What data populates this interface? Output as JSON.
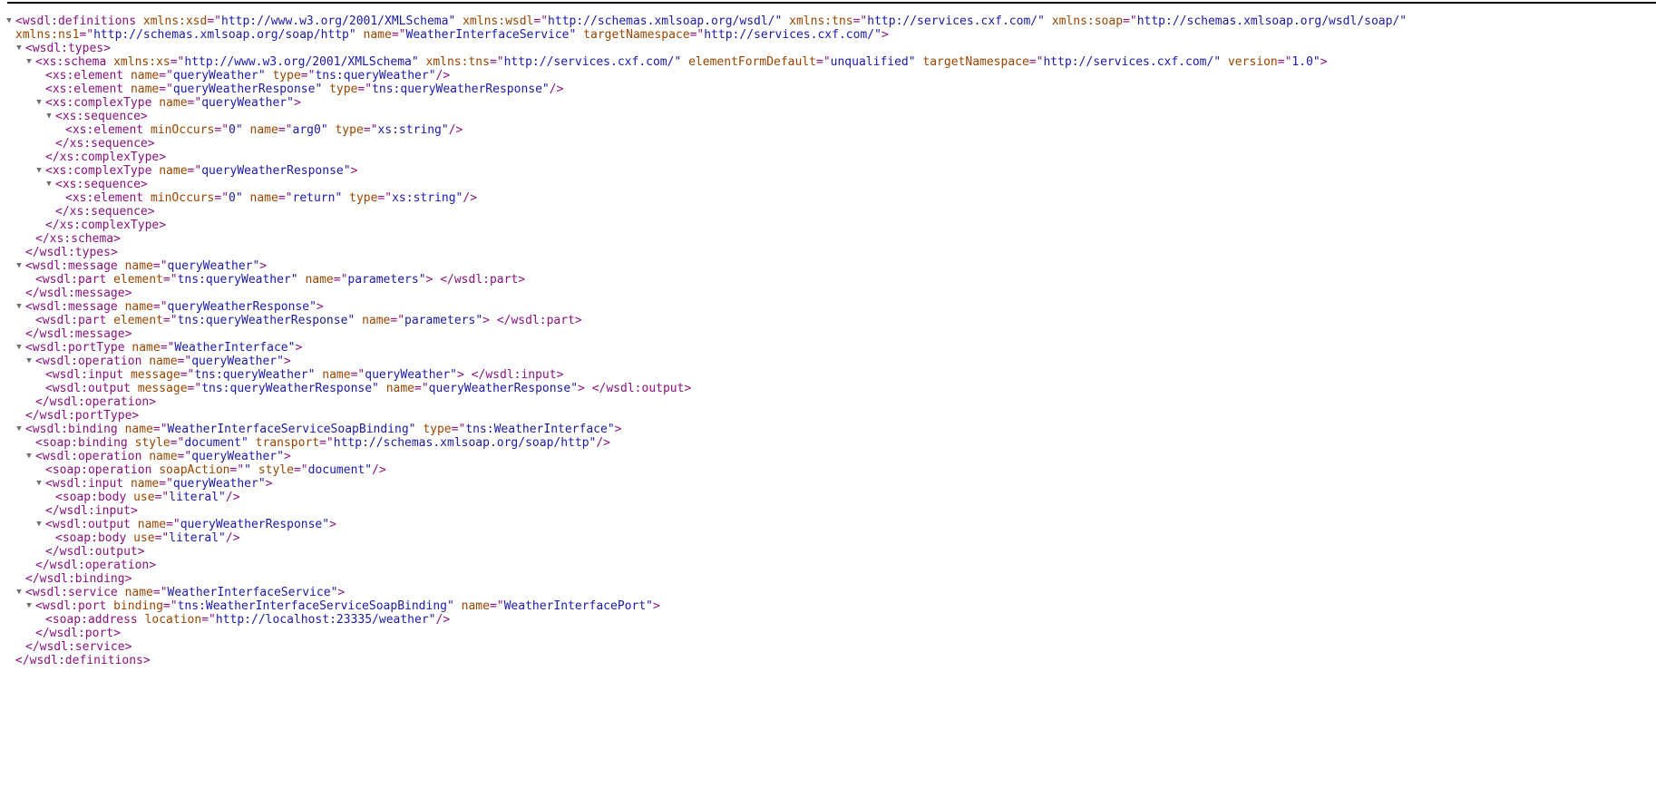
{
  "caret_glyph": "▼",
  "colors": {
    "tag": "#881280",
    "attribute_name": "#994500",
    "attribute_value": "#1a1aa6",
    "caret": "#6e6e6e",
    "rule": "#000000"
  },
  "lines": [
    {
      "indent": 0,
      "caret": true,
      "close": false,
      "tag": "wsdl:definitions",
      "attrs": [
        [
          "xmlns:xsd",
          "http://www.w3.org/2001/XMLSchema"
        ],
        [
          "xmlns:wsdl",
          "http://schemas.xmlsoap.org/wsdl/"
        ],
        [
          "xmlns:tns",
          "http://services.cxf.com/"
        ],
        [
          "xmlns:soap",
          "http://schemas.xmlsoap.org/wsdl/soap/"
        ]
      ],
      "end": ""
    },
    {
      "indent": 0,
      "cont": true,
      "close": false,
      "tag": "",
      "attrs": [
        [
          "xmlns:ns1",
          "http://schemas.xmlsoap.org/soap/http"
        ],
        [
          "name",
          "WeatherInterfaceService"
        ],
        [
          "targetNamespace",
          "http://services.cxf.com/"
        ]
      ],
      "end": ">"
    },
    {
      "indent": 1,
      "caret": true,
      "close": false,
      "tag": "wsdl:types",
      "attrs": [],
      "end": ">"
    },
    {
      "indent": 2,
      "caret": true,
      "close": false,
      "tag": "xs:schema",
      "attrs": [
        [
          "xmlns:xs",
          "http://www.w3.org/2001/XMLSchema"
        ],
        [
          "xmlns:tns",
          "http://services.cxf.com/"
        ],
        [
          "elementFormDefault",
          "unqualified"
        ],
        [
          "targetNamespace",
          "http://services.cxf.com/"
        ],
        [
          "version",
          "1.0"
        ]
      ],
      "end": ">"
    },
    {
      "indent": 3,
      "close": false,
      "tag": "xs:element",
      "attrs": [
        [
          "name",
          "queryWeather"
        ],
        [
          "type",
          "tns:queryWeather"
        ]
      ],
      "end": "/>"
    },
    {
      "indent": 3,
      "close": false,
      "tag": "xs:element",
      "attrs": [
        [
          "name",
          "queryWeatherResponse"
        ],
        [
          "type",
          "tns:queryWeatherResponse"
        ]
      ],
      "end": "/>"
    },
    {
      "indent": 3,
      "caret": true,
      "close": false,
      "tag": "xs:complexType",
      "attrs": [
        [
          "name",
          "queryWeather"
        ]
      ],
      "end": ">"
    },
    {
      "indent": 4,
      "caret": true,
      "close": false,
      "tag": "xs:sequence",
      "attrs": [],
      "end": ">"
    },
    {
      "indent": 5,
      "close": false,
      "tag": "xs:element",
      "attrs": [
        [
          "minOccurs",
          "0"
        ],
        [
          "name",
          "arg0"
        ],
        [
          "type",
          "xs:string"
        ]
      ],
      "end": "/>"
    },
    {
      "indent": 4,
      "close": true,
      "tag": "xs:sequence",
      "attrs": [],
      "end": ">"
    },
    {
      "indent": 3,
      "close": true,
      "tag": "xs:complexType",
      "attrs": [],
      "end": ">"
    },
    {
      "indent": 3,
      "caret": true,
      "close": false,
      "tag": "xs:complexType",
      "attrs": [
        [
          "name",
          "queryWeatherResponse"
        ]
      ],
      "end": ">"
    },
    {
      "indent": 4,
      "caret": true,
      "close": false,
      "tag": "xs:sequence",
      "attrs": [],
      "end": ">"
    },
    {
      "indent": 5,
      "close": false,
      "tag": "xs:element",
      "attrs": [
        [
          "minOccurs",
          "0"
        ],
        [
          "name",
          "return"
        ],
        [
          "type",
          "xs:string"
        ]
      ],
      "end": "/>"
    },
    {
      "indent": 4,
      "close": true,
      "tag": "xs:sequence",
      "attrs": [],
      "end": ">"
    },
    {
      "indent": 3,
      "close": true,
      "tag": "xs:complexType",
      "attrs": [],
      "end": ">"
    },
    {
      "indent": 2,
      "close": true,
      "tag": "xs:schema",
      "attrs": [],
      "end": ">"
    },
    {
      "indent": 1,
      "close": true,
      "tag": "wsdl:types",
      "attrs": [],
      "end": ">"
    },
    {
      "indent": 1,
      "caret": true,
      "close": false,
      "tag": "wsdl:message",
      "attrs": [
        [
          "name",
          "queryWeather"
        ]
      ],
      "end": ">"
    },
    {
      "indent": 2,
      "close": false,
      "tag": "wsdl:part",
      "attrs": [
        [
          "element",
          "tns:queryWeather"
        ],
        [
          "name",
          "parameters"
        ]
      ],
      "end": ">",
      "closing": "wsdl:part"
    },
    {
      "indent": 1,
      "close": true,
      "tag": "wsdl:message",
      "attrs": [],
      "end": ">"
    },
    {
      "indent": 1,
      "caret": true,
      "close": false,
      "tag": "wsdl:message",
      "attrs": [
        [
          "name",
          "queryWeatherResponse"
        ]
      ],
      "end": ">"
    },
    {
      "indent": 2,
      "close": false,
      "tag": "wsdl:part",
      "attrs": [
        [
          "element",
          "tns:queryWeatherResponse"
        ],
        [
          "name",
          "parameters"
        ]
      ],
      "end": ">",
      "closing": "wsdl:part"
    },
    {
      "indent": 1,
      "close": true,
      "tag": "wsdl:message",
      "attrs": [],
      "end": ">"
    },
    {
      "indent": 1,
      "caret": true,
      "close": false,
      "tag": "wsdl:portType",
      "attrs": [
        [
          "name",
          "WeatherInterface"
        ]
      ],
      "end": ">"
    },
    {
      "indent": 2,
      "caret": true,
      "close": false,
      "tag": "wsdl:operation",
      "attrs": [
        [
          "name",
          "queryWeather"
        ]
      ],
      "end": ">"
    },
    {
      "indent": 3,
      "close": false,
      "tag": "wsdl:input",
      "attrs": [
        [
          "message",
          "tns:queryWeather"
        ],
        [
          "name",
          "queryWeather"
        ]
      ],
      "end": ">",
      "closing": "wsdl:input"
    },
    {
      "indent": 3,
      "close": false,
      "tag": "wsdl:output",
      "attrs": [
        [
          "message",
          "tns:queryWeatherResponse"
        ],
        [
          "name",
          "queryWeatherResponse"
        ]
      ],
      "end": ">",
      "closing": "wsdl:output"
    },
    {
      "indent": 2,
      "close": true,
      "tag": "wsdl:operation",
      "attrs": [],
      "end": ">"
    },
    {
      "indent": 1,
      "close": true,
      "tag": "wsdl:portType",
      "attrs": [],
      "end": ">"
    },
    {
      "indent": 1,
      "caret": true,
      "close": false,
      "tag": "wsdl:binding",
      "attrs": [
        [
          "name",
          "WeatherInterfaceServiceSoapBinding"
        ],
        [
          "type",
          "tns:WeatherInterface"
        ]
      ],
      "end": ">"
    },
    {
      "indent": 2,
      "close": false,
      "tag": "soap:binding",
      "attrs": [
        [
          "style",
          "document"
        ],
        [
          "transport",
          "http://schemas.xmlsoap.org/soap/http"
        ]
      ],
      "end": "/>"
    },
    {
      "indent": 2,
      "caret": true,
      "close": false,
      "tag": "wsdl:operation",
      "attrs": [
        [
          "name",
          "queryWeather"
        ]
      ],
      "end": ">"
    },
    {
      "indent": 3,
      "close": false,
      "tag": "soap:operation",
      "attrs": [
        [
          "soapAction",
          ""
        ],
        [
          "style",
          "document"
        ]
      ],
      "end": "/>"
    },
    {
      "indent": 3,
      "caret": true,
      "close": false,
      "tag": "wsdl:input",
      "attrs": [
        [
          "name",
          "queryWeather"
        ]
      ],
      "end": ">"
    },
    {
      "indent": 4,
      "close": false,
      "tag": "soap:body",
      "attrs": [
        [
          "use",
          "literal"
        ]
      ],
      "end": "/>"
    },
    {
      "indent": 3,
      "close": true,
      "tag": "wsdl:input",
      "attrs": [],
      "end": ">"
    },
    {
      "indent": 3,
      "caret": true,
      "close": false,
      "tag": "wsdl:output",
      "attrs": [
        [
          "name",
          "queryWeatherResponse"
        ]
      ],
      "end": ">"
    },
    {
      "indent": 4,
      "close": false,
      "tag": "soap:body",
      "attrs": [
        [
          "use",
          "literal"
        ]
      ],
      "end": "/>"
    },
    {
      "indent": 3,
      "close": true,
      "tag": "wsdl:output",
      "attrs": [],
      "end": ">"
    },
    {
      "indent": 2,
      "close": true,
      "tag": "wsdl:operation",
      "attrs": [],
      "end": ">"
    },
    {
      "indent": 1,
      "close": true,
      "tag": "wsdl:binding",
      "attrs": [],
      "end": ">"
    },
    {
      "indent": 1,
      "caret": true,
      "close": false,
      "tag": "wsdl:service",
      "attrs": [
        [
          "name",
          "WeatherInterfaceService"
        ]
      ],
      "end": ">"
    },
    {
      "indent": 2,
      "caret": true,
      "close": false,
      "tag": "wsdl:port",
      "attrs": [
        [
          "binding",
          "tns:WeatherInterfaceServiceSoapBinding"
        ],
        [
          "name",
          "WeatherInterfacePort"
        ]
      ],
      "end": ">"
    },
    {
      "indent": 3,
      "close": false,
      "tag": "soap:address",
      "attrs": [
        [
          "location",
          "http://localhost:23335/weather"
        ]
      ],
      "end": "/>"
    },
    {
      "indent": 2,
      "close": true,
      "tag": "wsdl:port",
      "attrs": [],
      "end": ">"
    },
    {
      "indent": 1,
      "close": true,
      "tag": "wsdl:service",
      "attrs": [],
      "end": ">"
    },
    {
      "indent": 0,
      "close": true,
      "tag": "wsdl:definitions",
      "attrs": [],
      "end": ">"
    }
  ]
}
